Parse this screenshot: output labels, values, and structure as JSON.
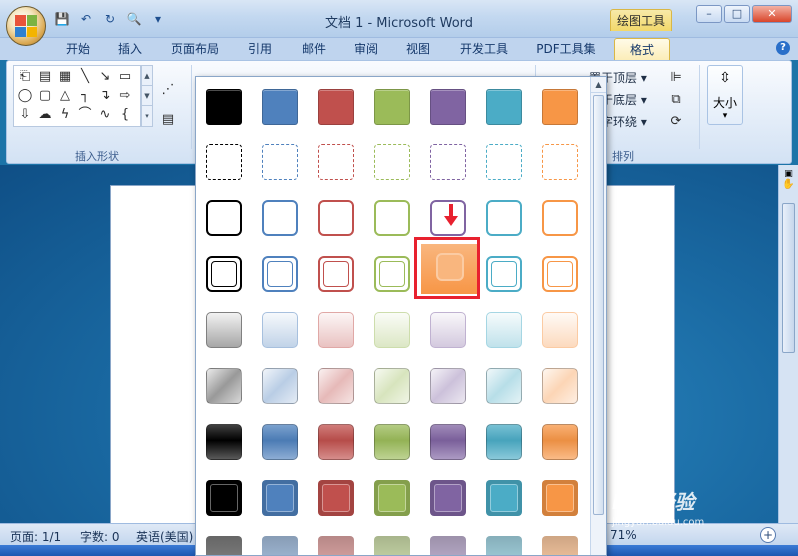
{
  "window": {
    "title": "文档 1 - Microsoft Word",
    "contextual_tab": "绘图工具",
    "buttons": [
      "–",
      "□",
      "✕"
    ]
  },
  "tabs": [
    {
      "label": "开始"
    },
    {
      "label": "插入"
    },
    {
      "label": "页面布局"
    },
    {
      "label": "引用"
    },
    {
      "label": "邮件"
    },
    {
      "label": "审阅"
    },
    {
      "label": "视图"
    },
    {
      "label": "开发工具"
    },
    {
      "label": "PDF工具集"
    },
    {
      "label": "格式",
      "active": true
    }
  ],
  "ribbon": {
    "insert_shapes_label": "插入形状",
    "arrange_label": "排列",
    "arrange_items": [
      "置于顶层",
      "置于底层",
      "文字环绕"
    ],
    "size_label": "大小"
  },
  "statusbar": {
    "page": "页面: 1/1",
    "words": "字数: 0",
    "language": "英语(美国)",
    "zoom": "71%"
  },
  "watermark": {
    "brand": "Bai 经验",
    "url": "jingyan.baidu.com"
  },
  "colors": {
    "black": "#000000",
    "blue": "#4f81bd",
    "red": "#c0504d",
    "green": "#9bbb59",
    "purple": "#8064a2",
    "aqua": "#4bacc6",
    "orange": "#f79646",
    "highlight": "#e8212f"
  },
  "gallery": {
    "rows": [
      "solid",
      "dashed",
      "outline",
      "double",
      "light",
      "glass",
      "gradient",
      "boxed",
      "dark"
    ],
    "columns": [
      "black",
      "blue",
      "red",
      "green",
      "purple",
      "aqua",
      "orange"
    ],
    "selected": {
      "row": "double",
      "column": "purple"
    }
  }
}
